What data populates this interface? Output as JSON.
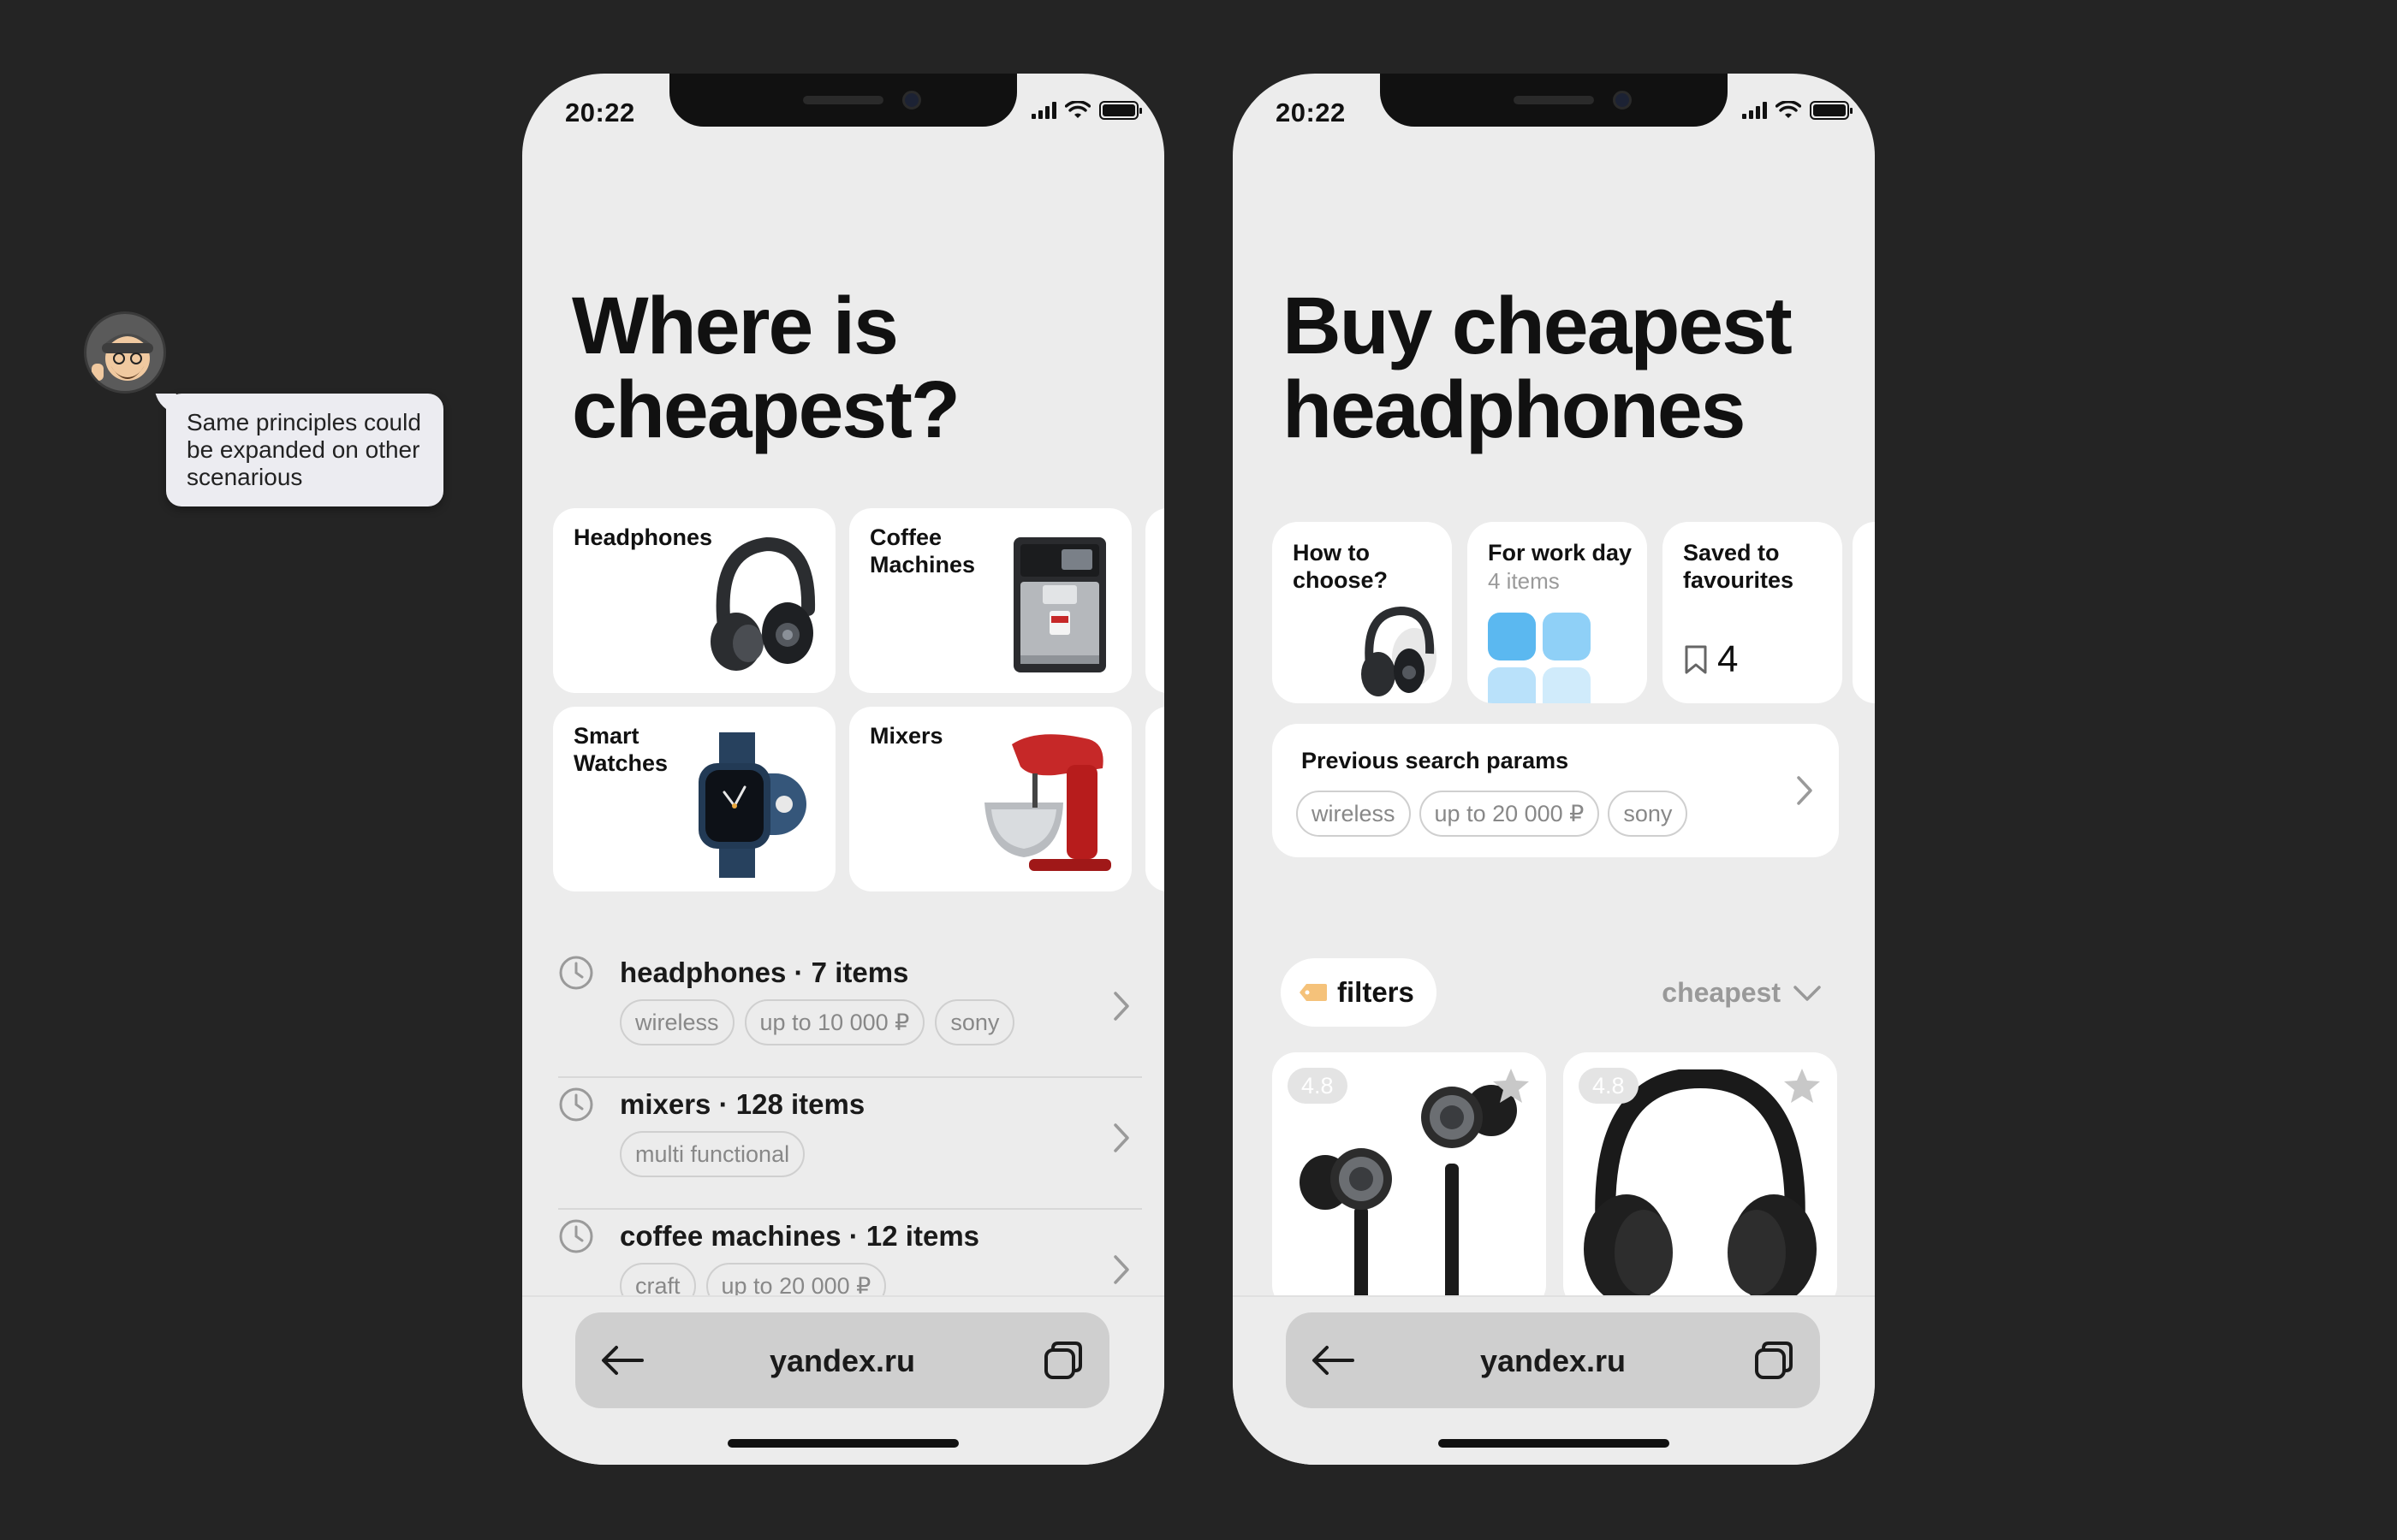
{
  "comment": {
    "text": "Same principles could be expanded on other scenarious"
  },
  "phone1": {
    "status_time": "20:22",
    "headline_line1": "Where is",
    "headline_line2": "cheapest?",
    "categories": [
      {
        "label": "Headphones",
        "icon": "headphones-icon"
      },
      {
        "label": "Coffee Machines",
        "icon": "coffee-machine-icon"
      },
      {
        "label": "Smart Watches",
        "icon": "smart-watch-icon"
      },
      {
        "label": "Mixers",
        "icon": "mixer-icon"
      }
    ],
    "history": [
      {
        "title": "headphones · 7 items",
        "chips": [
          "wireless",
          "up to 10 000 ₽",
          "sony"
        ]
      },
      {
        "title": "mixers · 128 items",
        "chips": [
          "multi functional"
        ]
      },
      {
        "title": "coffee machines · 12 items",
        "chips": [
          "craft",
          "up to 20 000 ₽"
        ]
      }
    ],
    "url": "yandex.ru"
  },
  "phone2": {
    "status_time": "20:22",
    "headline_line1": "Buy cheapest",
    "headline_line2": "headphones",
    "info_cards": {
      "how_to_choose": "How to choose?",
      "work_day_title": "For work day",
      "work_day_sub": "4 items",
      "saved_title": "Saved to favourites",
      "saved_count": "4"
    },
    "previous_search": {
      "title": "Previous search params",
      "chips": [
        "wireless",
        "up to 20 000 ₽",
        "sony"
      ]
    },
    "filters_label": "filters",
    "sort_label": "cheapest",
    "products": [
      {
        "rating": "4.8",
        "icon": "earbuds-icon"
      },
      {
        "rating": "4.8",
        "icon": "headphones-icon"
      }
    ],
    "url": "yandex.ru"
  },
  "colors": {
    "background": "#242424",
    "phone_bg": "#ececec",
    "card_bg": "#ffffff",
    "chip_text": "#888888",
    "tile_blue_1": "#5bb8f0",
    "tile_blue_2": "#8fd0f7",
    "tile_blue_3": "#b9e1fa",
    "tile_blue_4": "#d0ebfb"
  }
}
